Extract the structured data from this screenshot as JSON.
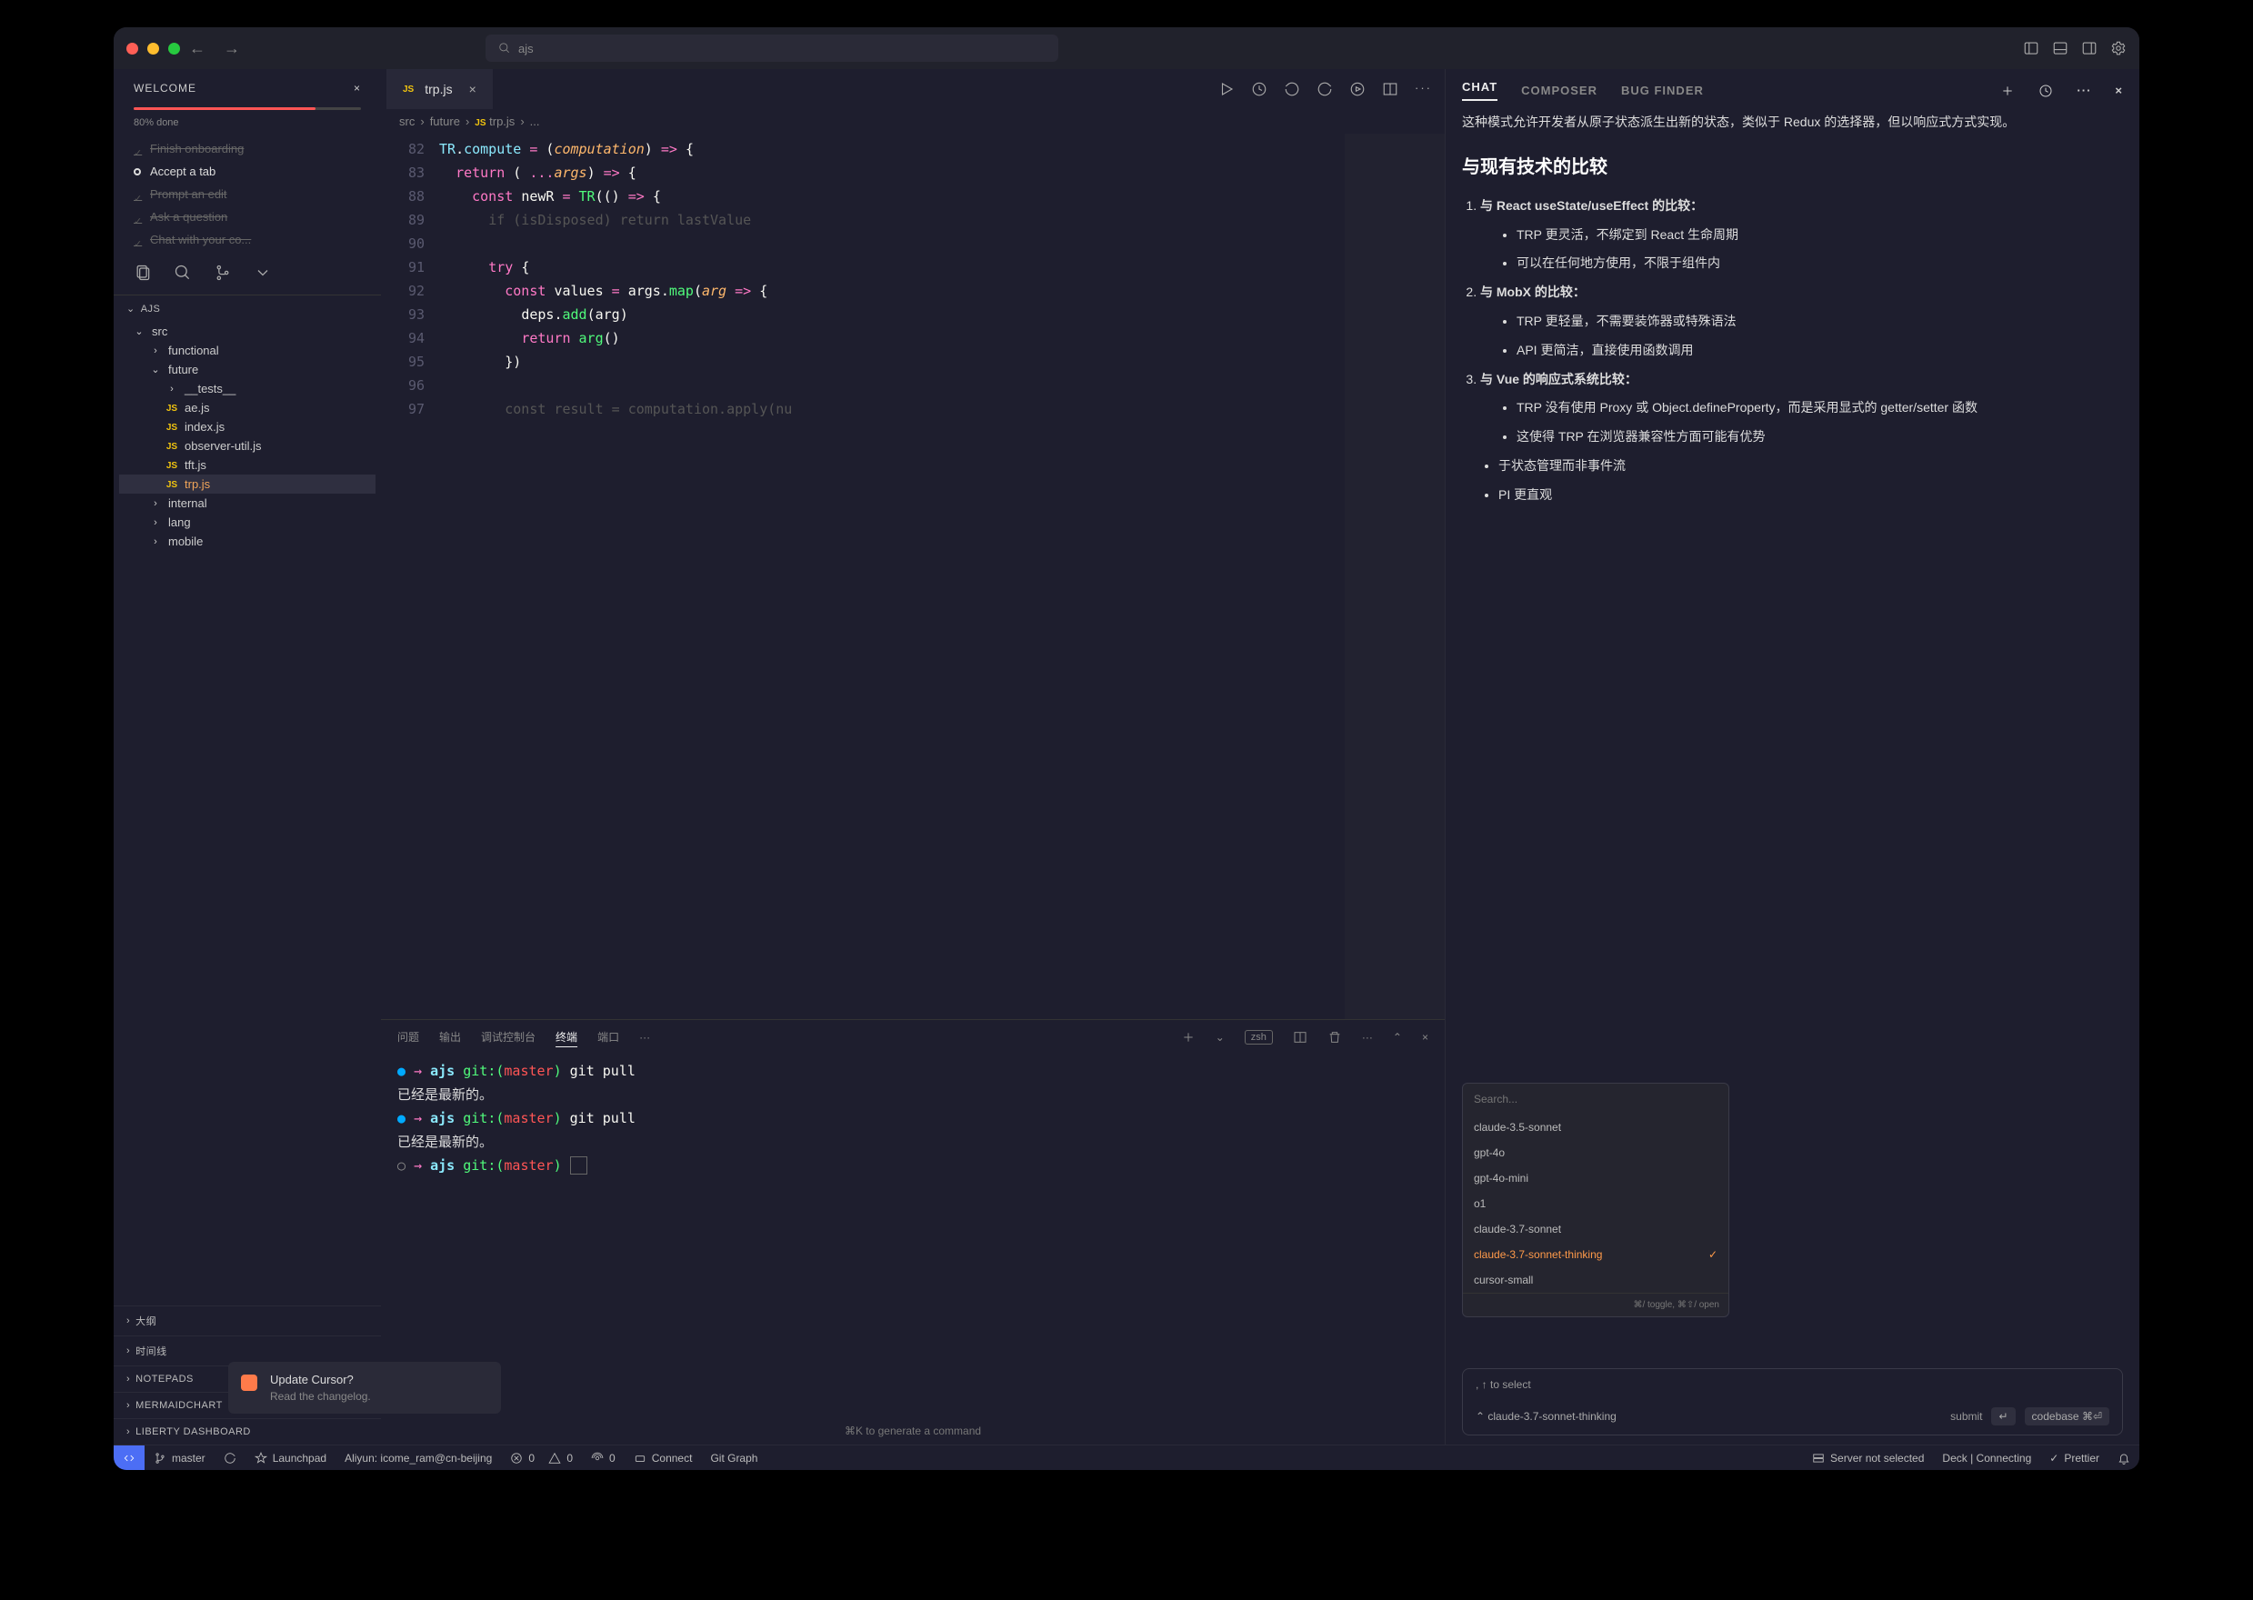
{
  "titlebar": {
    "search_value": "ajs"
  },
  "welcome": {
    "title": "WELCOME",
    "progress_label": "80% done",
    "steps": [
      {
        "label": "Finish onboarding",
        "state": "done"
      },
      {
        "label": "Accept a tab",
        "state": "active"
      },
      {
        "label": "Prompt an edit",
        "state": "done"
      },
      {
        "label": "Ask a question",
        "state": "done"
      },
      {
        "label": "Chat with your co...",
        "state": "done"
      }
    ]
  },
  "explorer": {
    "root": "AJS",
    "tree": [
      {
        "label": "src",
        "type": "folder",
        "open": true,
        "indent": 0
      },
      {
        "label": "functional",
        "type": "folder",
        "open": false,
        "indent": 1
      },
      {
        "label": "future",
        "type": "folder",
        "open": true,
        "indent": 1
      },
      {
        "label": "__tests__",
        "type": "folder",
        "open": false,
        "indent": 2
      },
      {
        "label": "ae.js",
        "type": "js",
        "indent": 2
      },
      {
        "label": "index.js",
        "type": "js",
        "indent": 2
      },
      {
        "label": "observer-util.js",
        "type": "js",
        "indent": 2
      },
      {
        "label": "tft.js",
        "type": "js",
        "indent": 2
      },
      {
        "label": "trp.js",
        "type": "js",
        "indent": 2,
        "selected": true
      },
      {
        "label": "internal",
        "type": "folder",
        "open": false,
        "indent": 1
      },
      {
        "label": "lang",
        "type": "folder",
        "open": false,
        "indent": 1
      },
      {
        "label": "mobile",
        "type": "folder",
        "open": false,
        "indent": 1
      }
    ],
    "sections": [
      "大纲",
      "时间线",
      "NOTEPADS",
      "MERMAIDCHART",
      "LIBERTY DASHBOARD"
    ]
  },
  "editor": {
    "tab_label": "trp.js",
    "breadcrumb": [
      "src",
      "future",
      "trp.js",
      "..."
    ],
    "lines": [
      {
        "n": 82,
        "html": "<span class='c-cls'>TR</span><span class='c-punc'>.</span><span class='c-prop'>compute</span> <span class='c-kw'>=</span> <span class='c-punc'>(</span><span class='c-param'>computation</span><span class='c-punc'>)</span> <span class='c-kw'>=&gt;</span> <span class='c-punc'>{</span>"
      },
      {
        "n": 83,
        "html": "  <span class='c-kw'>return</span> <span class='c-punc'>(</span> <span class='c-kw'>...</span><span class='c-param'>args</span><span class='c-punc'>)</span> <span class='c-kw'>=&gt;</span> <span class='c-punc'>{</span>"
      },
      {
        "n": 88,
        "html": "    <span class='c-kw'>const</span> <span class='c-var'>newR</span> <span class='c-kw'>=</span> <span class='c-fn'>TR</span><span class='c-punc'>(()</span> <span class='c-kw'>=&gt;</span> <span class='c-punc'>{</span>"
      },
      {
        "n": 89,
        "html": "      <span class='c-dim'>if (isDisposed) return lastValue</span>"
      },
      {
        "n": 90,
        "html": ""
      },
      {
        "n": 91,
        "html": "      <span class='c-kw'>try</span> <span class='c-punc'>{</span>"
      },
      {
        "n": 92,
        "html": "        <span class='c-kw'>const</span> <span class='c-var'>values</span> <span class='c-kw'>=</span> <span class='c-var'>args</span><span class='c-punc'>.</span><span class='c-fn'>map</span><span class='c-punc'>(</span><span class='c-param'>arg</span> <span class='c-kw'>=&gt;</span> <span class='c-punc'>{</span>"
      },
      {
        "n": 93,
        "html": "          <span class='c-var'>deps</span><span class='c-punc'>.</span><span class='c-fn'>add</span><span class='c-punc'>(</span><span class='c-var'>arg</span><span class='c-punc'>)</span>"
      },
      {
        "n": 94,
        "html": "          <span class='c-kw'>return</span> <span class='c-fn'>arg</span><span class='c-punc'>()</span>"
      },
      {
        "n": 95,
        "html": "        <span class='c-punc'>})</span>"
      },
      {
        "n": 96,
        "html": ""
      },
      {
        "n": 97,
        "html": "        <span class='c-dim'>const result = computation.apply(nu</span>"
      }
    ]
  },
  "panel": {
    "tabs": [
      "问题",
      "输出",
      "调试控制台",
      "终端",
      "端口"
    ],
    "active_tab": "终端",
    "shell_label": "zsh",
    "terminal_lines": [
      {
        "html": "<span class='t-bullet'>●</span> <span class='t-pink'>→</span>  <span class='t-cyan'>ajs</span> <span class='t-green'>git:(</span><span class='t-red'>master</span><span class='t-green'>)</span> <span class='c-punc'>git pull</span>"
      },
      {
        "html": "已经是最新的。"
      },
      {
        "html": "<span class='t-bullet'>●</span> <span class='t-pink'>→</span>  <span class='t-cyan'>ajs</span> <span class='t-green'>git:(</span><span class='t-red'>master</span><span class='t-green'>)</span> <span class='c-punc'>git pull</span>"
      },
      {
        "html": "已经是最新的。"
      },
      {
        "html": "<span class='t-dim'>○</span> <span class='t-pink'>→</span>  <span class='t-cyan'>ajs</span> <span class='t-green'>git:(</span><span class='t-red'>master</span><span class='t-green'>)</span> <span style='border:1px solid #666;padding:0 4px;'>&nbsp;</span>"
      }
    ],
    "footer": "⌘K to generate a command"
  },
  "chat": {
    "tabs": [
      "CHAT",
      "COMPOSER",
      "BUG FINDER"
    ],
    "intro": "这种模式允许开发者从原子状态派生出新的状态，类似于 Redux 的选择器，但以响应式方式实现。",
    "heading": "与现有技术的比较",
    "items": [
      {
        "title": "与 React useState/useEffect 的比较：",
        "bullets": [
          "TRP 更灵活，不绑定到 React 生命周期",
          "可以在任何地方使用，不限于组件内"
        ]
      },
      {
        "title": "与 MobX 的比较：",
        "bullets": [
          "TRP 更轻量，不需要装饰器或特殊语法",
          "API 更简洁，直接使用函数调用"
        ]
      },
      {
        "title": "与 Vue 的响应式系统比较：",
        "bullets": [
          "TRP 没有使用 Proxy 或 Object.defineProperty，而是采用显式的 getter/setter 函数",
          "这使得 TRP 在浏览器兼容性方面可能有优势"
        ]
      }
    ],
    "partial1": "于状态管理而非事件流",
    "partial2": "PI 更直观",
    "input_placeholder": ", ↑ to select",
    "model_search_ph": "Search...",
    "models": [
      "claude-3.5-sonnet",
      "gpt-4o",
      "gpt-4o-mini",
      "o1",
      "claude-3.7-sonnet",
      "claude-3.7-sonnet-thinking",
      "cursor-small"
    ],
    "model_selected": "claude-3.7-sonnet-thinking",
    "model_hint": "⌘/ toggle, ⌘⇧/ open",
    "submit_label": "submit",
    "codebase_label": "codebase",
    "submit_key": "↵",
    "codebase_key": "⌘⏎"
  },
  "notif": {
    "title": "Update Cursor?",
    "sub": "Read the changelog."
  },
  "statusbar": {
    "items_left": [
      "master",
      "Launchpad",
      "Aliyun: icome_ram@cn-beijing",
      "0",
      "0",
      "0",
      "Connect",
      "Git Graph"
    ],
    "items_right": [
      "Server not selected",
      "Deck | Connecting",
      "Prettier"
    ]
  }
}
